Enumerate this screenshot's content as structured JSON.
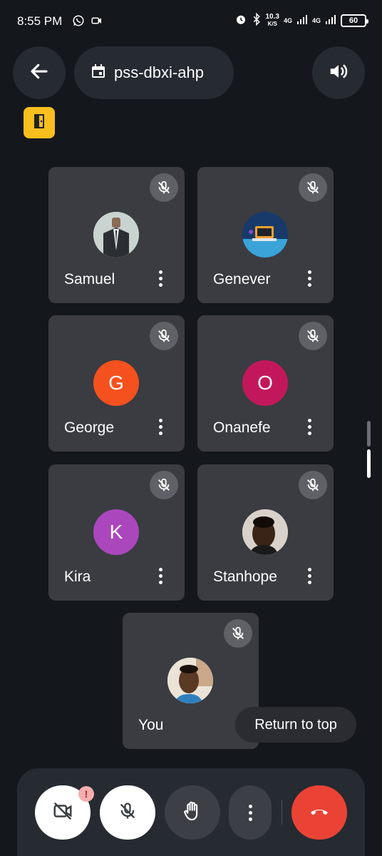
{
  "status_bar": {
    "time": "8:55 PM",
    "speed_value": "10.3",
    "speed_unit": "K/S",
    "network_1": "4G",
    "network_2": "4G",
    "battery": "60",
    "icons": [
      "whatsapp-icon",
      "video-record-icon",
      "alarm-icon",
      "bluetooth-icon",
      "signal-icon"
    ]
  },
  "header": {
    "meeting_code": "pss-dbxi-ahp",
    "back_icon": "arrow-back-icon",
    "calendar_icon": "calendar-icon",
    "speaker_icon": "volume-icon",
    "host_badge_icon": "door-icon",
    "host_badge_color": "#f9bf1e"
  },
  "participants": [
    {
      "name": "Samuel",
      "initial": "",
      "avatar_type": "photo",
      "muted": true
    },
    {
      "name": "Genever",
      "initial": "",
      "avatar_type": "photo",
      "muted": true
    },
    {
      "name": "George",
      "initial": "G",
      "avatar_color": "#f4511e",
      "muted": true
    },
    {
      "name": "Onanefe",
      "initial": "O",
      "avatar_color": "#c2185b",
      "muted": true
    },
    {
      "name": "Kira",
      "initial": "K",
      "avatar_color": "#ab47bc",
      "muted": true
    },
    {
      "name": "Stanhope",
      "initial": "",
      "avatar_type": "photo",
      "muted": true
    },
    {
      "name": "You",
      "initial": "",
      "avatar_type": "photo",
      "muted": true
    }
  ],
  "toast": {
    "label": "Return to top"
  },
  "controls": {
    "camera_icon": "video-off-icon",
    "camera_alert": "!",
    "mic_icon": "mic-off-icon",
    "hand_icon": "raise-hand-icon",
    "more_icon": "more-vertical-icon",
    "end_icon": "call-end-icon",
    "end_color": "#ea4335"
  }
}
